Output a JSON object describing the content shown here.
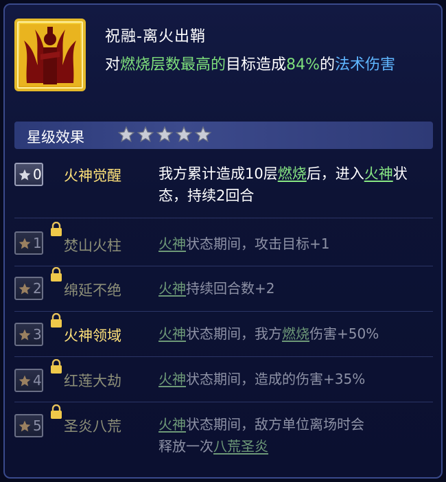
{
  "skill": {
    "name": "祝融-离火出鞘",
    "desc_parts": {
      "p1": "对",
      "p2": "燃烧层数最高的",
      "p3": "目标造成",
      "p4": "84%",
      "p5": "的",
      "p6": "法术伤害"
    },
    "icon": "fire-deity-icon"
  },
  "star_effects": {
    "header": "星级效果",
    "stars_shown": 5,
    "tiers": [
      {
        "level": "0",
        "name": "火神觉醒",
        "locked": false,
        "parts": {
          "a": "我方累计造成10层",
          "b": "燃烧",
          "c": "后，进入",
          "d": "火神",
          "e": "状态，持续2回合"
        }
      },
      {
        "level": "1",
        "name": "焚山火柱",
        "locked": true,
        "parts": {
          "a": "火神",
          "b": "状态期间，攻击目标+1"
        }
      },
      {
        "level": "2",
        "name": "绵延不绝",
        "locked": true,
        "parts": {
          "a": "火神",
          "b": "持续回合数+2"
        }
      },
      {
        "level": "3",
        "name": "火神领域",
        "locked": true,
        "parts": {
          "a": "火神",
          "b": "状态期间，我方",
          "c": "燃烧",
          "d": "伤害+50%"
        }
      },
      {
        "level": "4",
        "name": "红莲大劫",
        "locked": true,
        "parts": {
          "a": "火神",
          "b": "状态期间，造成的伤害+35%"
        }
      },
      {
        "level": "5",
        "name": "圣炎八荒",
        "locked": true,
        "parts": {
          "a": "火神",
          "b": "状态期间，敌方单位离场时会",
          "c": "释放一次",
          "d": "八荒圣炎"
        }
      }
    ]
  },
  "colors": {
    "keyword_green": "#7ee07c",
    "keyword_blue": "#5fb6ff",
    "frame_gold": "#e4b92a"
  }
}
